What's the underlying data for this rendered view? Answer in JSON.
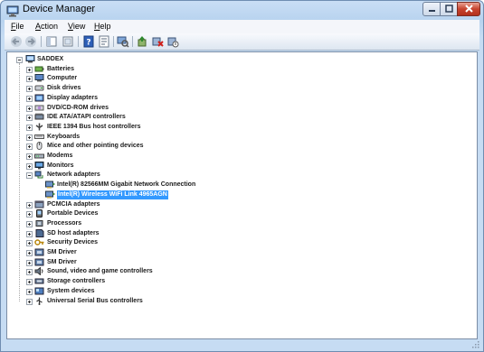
{
  "window": {
    "title": "Device Manager"
  },
  "menu": [
    {
      "label": "File",
      "accel": "F",
      "rest": "ile"
    },
    {
      "label": "Action",
      "accel": "A",
      "rest": "ction"
    },
    {
      "label": "View",
      "accel": "V",
      "rest": "iew"
    },
    {
      "label": "Help",
      "accel": "H",
      "rest": "elp"
    }
  ],
  "toolbar": {
    "buttons": [
      {
        "name": "back-button",
        "icon": "back-arrow-icon"
      },
      {
        "name": "forward-button",
        "icon": "forward-arrow-icon"
      },
      {
        "name": "up-button",
        "icon": "console-tree-icon"
      },
      {
        "name": "show-hide-button",
        "icon": "show-hide-icon"
      },
      {
        "name": "help-button",
        "icon": "help-icon"
      },
      {
        "name": "properties-button",
        "icon": "properties-icon"
      },
      {
        "name": "scan-button",
        "icon": "scan-hardware-icon"
      },
      {
        "name": "update-driver-button",
        "icon": "update-driver-icon"
      },
      {
        "name": "uninstall-button",
        "icon": "uninstall-icon"
      },
      {
        "name": "disable-button",
        "icon": "disable-icon"
      }
    ]
  },
  "tree": {
    "root": "SADDEX",
    "categories": [
      {
        "label": "Batteries",
        "icon": "battery-icon"
      },
      {
        "label": "Computer",
        "icon": "computer-icon"
      },
      {
        "label": "Disk drives",
        "icon": "disk-drive-icon"
      },
      {
        "label": "Display adapters",
        "icon": "display-adapter-icon"
      },
      {
        "label": "DVD/CD-ROM drives",
        "icon": "dvd-drive-icon"
      },
      {
        "label": "IDE ATA/ATAPI controllers",
        "icon": "ide-controller-icon"
      },
      {
        "label": "IEEE 1394 Bus host controllers",
        "icon": "firewire-icon"
      },
      {
        "label": "Keyboards",
        "icon": "keyboard-icon"
      },
      {
        "label": "Mice and other pointing devices",
        "icon": "mouse-icon"
      },
      {
        "label": "Modems",
        "icon": "modem-icon"
      },
      {
        "label": "Monitors",
        "icon": "monitor-icon"
      },
      {
        "label": "Network adapters",
        "icon": "network-adapter-icon",
        "expanded": true,
        "children": [
          {
            "label": "Intel(R) 82566MM Gigabit Network Connection",
            "icon": "network-card-icon"
          },
          {
            "label": "Intel(R) Wireless WiFi Link 4965AGN",
            "icon": "network-card-icon",
            "selected": true
          }
        ]
      },
      {
        "label": "PCMCIA adapters",
        "icon": "pcmcia-icon"
      },
      {
        "label": "Portable Devices",
        "icon": "portable-device-icon"
      },
      {
        "label": "Processors",
        "icon": "processor-icon"
      },
      {
        "label": "SD host adapters",
        "icon": "sd-host-icon"
      },
      {
        "label": "Security Devices",
        "icon": "security-device-icon"
      },
      {
        "label": "SM Driver",
        "icon": "sm-driver-icon"
      },
      {
        "label": "SM Driver",
        "icon": "sm-driver-icon"
      },
      {
        "label": "Sound, video and game controllers",
        "icon": "sound-icon"
      },
      {
        "label": "Storage controllers",
        "icon": "storage-controller-icon"
      },
      {
        "label": "System devices",
        "icon": "system-device-icon"
      },
      {
        "label": "Universal Serial Bus controllers",
        "icon": "usb-icon"
      }
    ]
  },
  "colors": {
    "selection": "#3399ff",
    "titlebar": "#c3d9f2",
    "close": "#c7432e"
  }
}
